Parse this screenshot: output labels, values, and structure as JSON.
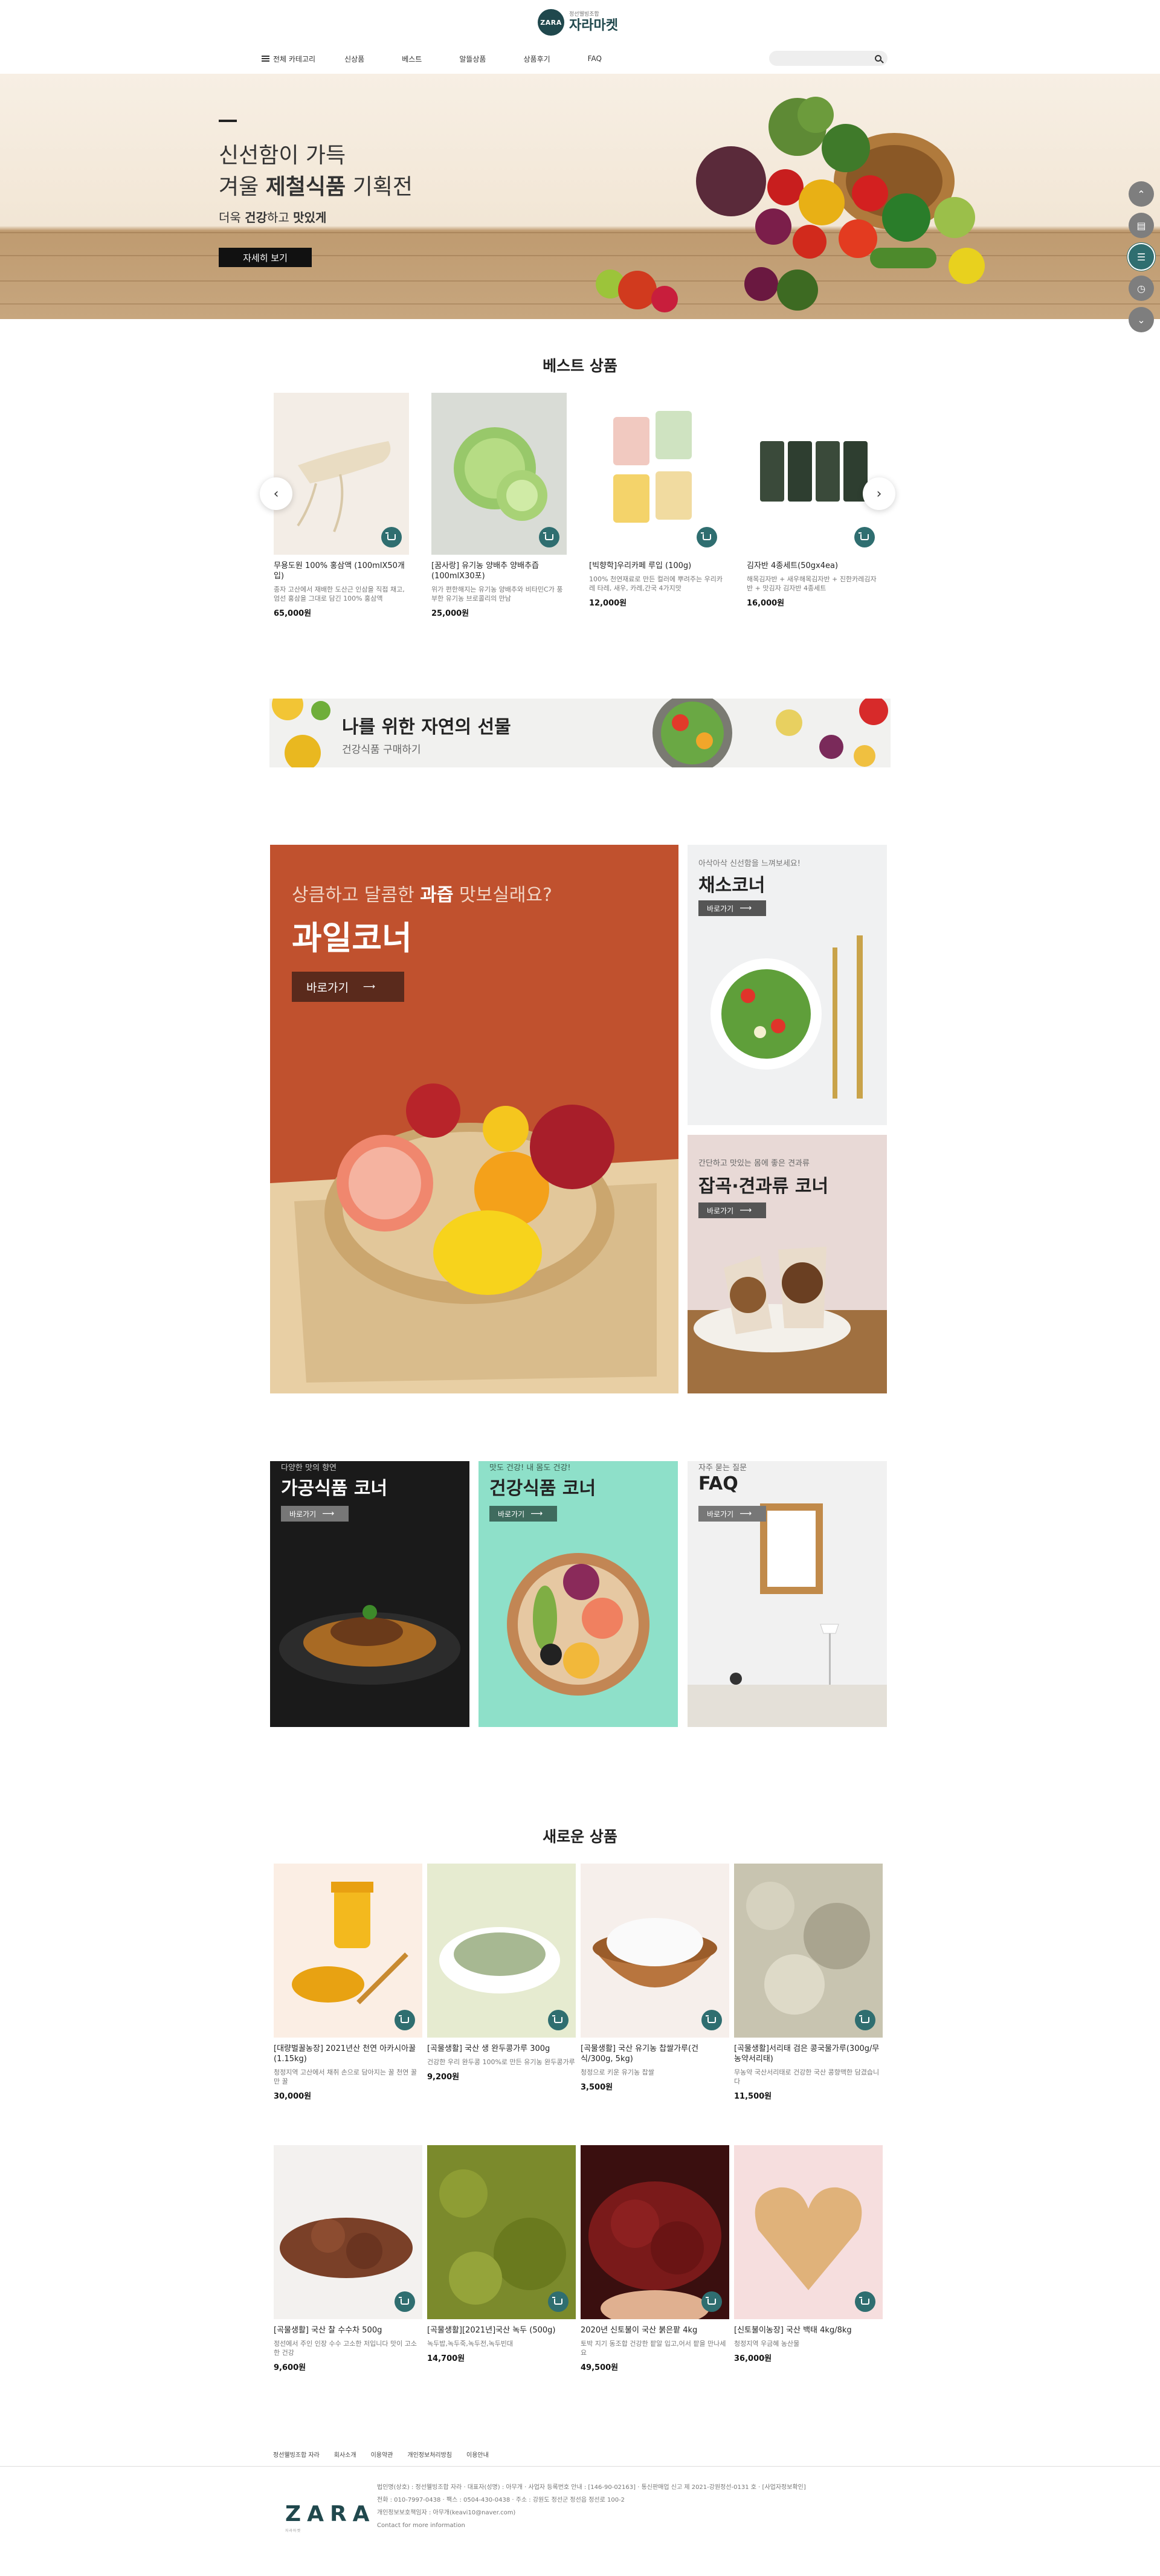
{
  "header": {
    "logo_badge": "ZARA",
    "logo_sub": "정선웰빙조합",
    "logo_main": "자라마켓",
    "all_category": "전체 카테고리",
    "nav": [
      "신상품",
      "베스트",
      "알뜰상품",
      "상품후기",
      "FAQ"
    ],
    "search_placeholder": ""
  },
  "hero": {
    "line1": "신선함이 가득",
    "line2_pre": "겨울 ",
    "line2_bold": "제철식품",
    "line2_post": " 기획전",
    "line3_pre": "더욱 ",
    "line3_b1": "건강",
    "line3_mid": "하고 ",
    "line3_b2": "맛있게",
    "button": "자세히 보기"
  },
  "quick_menu": [
    "up-icon",
    "cart-icon",
    "menu-icon",
    "history-icon",
    "down-icon"
  ],
  "best": {
    "title": "베스트 상품",
    "items": [
      {
        "name": "무용도원 100% 홍삼액 (100mlX50개입)",
        "desc": "종자 고산에서 재배한 도산근 인삼을 직접 채고, 엄선 홍삼을 그대로 담긴 100% 홍삼액",
        "price": "65,000원"
      },
      {
        "name": "[꿈사랑] 유기농 양배추 양배추즙\n(100mlX30포)",
        "desc": "위가 편한해지는 유기농 양배추와 비타민C가 풍부한 유기농 브로콜리의 만남",
        "price": "25,000원"
      },
      {
        "name": "[빅향학]우리카페 루입 (100g)",
        "desc": "100% 천연재료로 만든 컬러에 뿌려주는 우리카레 타레, 새우, 카레,간국 4가지맛",
        "price": "12,000원"
      },
      {
        "name": "김자반 4종세트(50gx4ea)",
        "desc": "해목김자반 + 새우해목김자반 + 진한카레김자반 + 맛김자 김자반 4종세트",
        "price": "16,000원"
      }
    ]
  },
  "banner": {
    "title": "나를 위한 자연의 선물",
    "sub": "건강식품 구매하기"
  },
  "corners": {
    "fruit": {
      "sub_pre": "상큼하고 달콤한 ",
      "sub_bold": "과즙",
      "sub_post": " 맛보실래요?",
      "title": "과일코너",
      "button": "바로가기"
    },
    "veg": {
      "sub": "아삭아삭 신선함을 느껴보세요!",
      "title": "채소코너",
      "button": "바로가기"
    },
    "nuts": {
      "sub": "간단하고 맛있는 몸에 좋은 견과류",
      "title": "잡곡·견과류 코너",
      "button": "바로가기"
    },
    "processed": {
      "sub": "다양한 맛의 향연",
      "title": "가공식품 코너",
      "button": "바로가기"
    },
    "health": {
      "sub": "맛도 건강! 내 몸도 건강!",
      "title": "건강식품 코너",
      "button": "바로가기"
    },
    "faq": {
      "sub": "자주 묻는 질문",
      "title": "FAQ",
      "button": "바로가기"
    }
  },
  "new_products": {
    "title": "새로운 상품",
    "items": [
      {
        "name": "[대량벌꿀농장] 2021년산 천연 아카시아꿀 (1.15kg)",
        "desc": "청정지역 고산에서 채취 손으로 담아지는 꿀 천연 꿀만 꿀",
        "price": "30,000원"
      },
      {
        "name": "[곡물생활] 국산 생 완두콩가루 300g",
        "desc": "건강한 우리 완두콩 100%로 만든 유기농 완두콩가루",
        "price": "9,200원"
      },
      {
        "name": "[곡물생활] 국산 유기농 찹쌀가루(건식/300g, 5kg)",
        "desc": "청정으로 키운 유기농 찹쌀",
        "price": "3,500원"
      },
      {
        "name": "[곡물생활]서리태 검은 콩국물가루(300g/무농약서리태)",
        "desc": "무농약 국산서리태로 건강한 국산 콩향맥한 담겼습니다",
        "price": "11,500원"
      },
      {
        "name": "[곡물생활] 국산 찰 수수차 500g",
        "desc": "정선에서 주인 인장 수수 고소한 저입니다 맛이 고소한 건강",
        "price": "9,600원"
      },
      {
        "name": "[곡물생활][2021년]국산 녹두 (500g)",
        "desc": "녹두밥,녹두죽,녹두전,녹두빈대",
        "price": "14,700원"
      },
      {
        "name": "2020년 신토불이 국산 붉은팥 4kg",
        "desc": "토박 지기 동조합 건강한 팥알 입고,어서 팥을 만나세요",
        "price": "49,500원"
      },
      {
        "name": "[신토불이농장] 국산 백태 4kg/8kg",
        "desc": "청정지역 우금혜 농산물",
        "price": "36,000원"
      }
    ]
  },
  "footer": {
    "links": [
      "정선웰빙조합 자라",
      "회사소개",
      "이용약관",
      "개인정보처리방침",
      "이용안내"
    ],
    "logo": "ZARA",
    "logo_sub": "자라마켓",
    "info": [
      "법인명(상호) : 정선웰빙조합 자라 · 대표자(성명) : 아무개 · 사업자 등록번호 안내 : [146-90-02163] · 통신판매업 신고 제 2021-강원정선-0131 호 · [사업자정보확인]",
      "전화 : 010-7997-0438 · 팩스 : 0504-430-0438 · 주소 : 강원도 정선군 정선읍 정선로 100-2",
      "개인정보보호책임자 : 아무개(keavi10@naver.com)",
      "Contact for more information"
    ]
  },
  "colors": {
    "accent": "#2f6e70",
    "dark": "#20484d",
    "fruit_bg": "#c0512e",
    "health_bg": "#8ee0c9"
  }
}
